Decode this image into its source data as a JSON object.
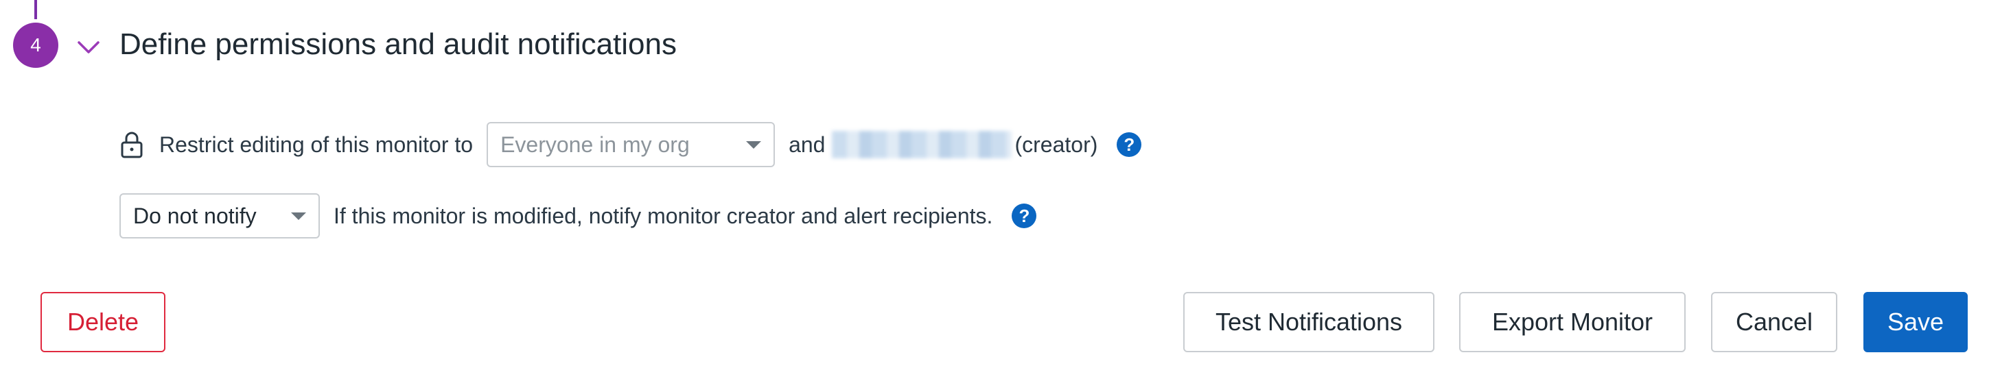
{
  "step": {
    "number": "4",
    "title": "Define permissions and audit notifications"
  },
  "restrict": {
    "label": "Restrict editing of this monitor to",
    "select_value": "Everyone in my org",
    "and_text": "and",
    "creator_text": "(creator)"
  },
  "notify": {
    "select_value": "Do not notify",
    "description": "If this monitor is modified, notify monitor creator and alert recipients."
  },
  "buttons": {
    "delete": "Delete",
    "test": "Test Notifications",
    "export": "Export Monitor",
    "cancel": "Cancel",
    "save": "Save"
  },
  "icons": {
    "lock": "lock-icon",
    "help": "question-icon",
    "chevron": "chevron-down-icon"
  },
  "colors": {
    "step_accent": "#8a2ea8",
    "primary": "#0d66c2",
    "danger": "#d61f35"
  }
}
